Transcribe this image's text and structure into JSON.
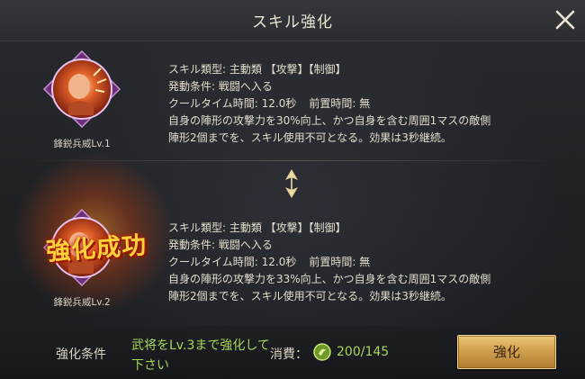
{
  "dialog": {
    "title": "スキル強化"
  },
  "current_skill": {
    "name": "鋒鋭兵威Lv.1",
    "type_line": "スキル類型: 主動類 【攻撃】【制御】",
    "trigger_line": "発動条件: 戦闘へ入る",
    "cooldown_label": "クールタイム時間: 12.0秒",
    "prep_label": "前置時間: 無",
    "effect_line1": "自身の陣形の攻撃力を30%向上、かつ自身を含む周囲1マスの敵側",
    "effect_line2": "陣形2個までを、スキル使用不可となる。効果は3秒継続。"
  },
  "next_skill": {
    "name": "鋒鋭兵威Lv.2",
    "type_line": "スキル類型: 主動類 【攻撃】【制御】",
    "trigger_line": "発動条件: 戦闘へ入る",
    "cooldown_label": "クールタイム時間: 12.0秒",
    "prep_label": "前置時間: 無",
    "effect_line1": "自身の陣形の攻撃力を33%向上、かつ自身を含む周囲1マスの敵側",
    "effect_line2": "陣形2個までを、スキル使用不可となる。効果は3秒継続。"
  },
  "success_overlay": {
    "text": "強化成功"
  },
  "footer": {
    "condition_label": "強化条件",
    "condition_text": "武将をLv.3まで強化して下さい",
    "cost_label": "消費：",
    "cost_value": "200/145",
    "button_label": "強化"
  },
  "icons": {
    "close": "close-icon",
    "arrow": "double-arrow-down-icon",
    "coin": "resource-coin-icon"
  },
  "colors": {
    "accent_green": "#a6d65a",
    "button_gold": "#d1a04e",
    "success_gold": "#ffd23c"
  }
}
